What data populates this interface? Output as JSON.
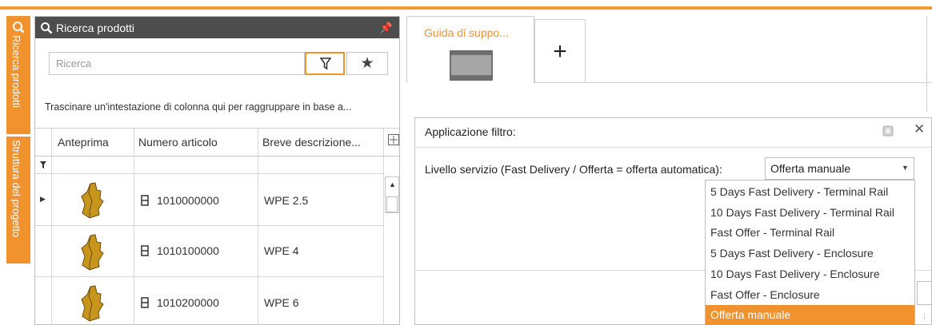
{
  "side_tabs": {
    "search_tab_label": "Ricerca prodotti",
    "project_tab_label": "Struttura del progetto"
  },
  "panel": {
    "title": "Ricerca prodotti",
    "search_placeholder": "Ricerca",
    "group_hint": "Trascinare un'intestazione di colonna qui per raggruppare in base a...",
    "columns": [
      "Anteprima",
      "Numero articolo",
      "Breve descrizione..."
    ],
    "rows": [
      {
        "number": "1010000000",
        "description": "WPE 2.5"
      },
      {
        "number": "1010100000",
        "description": "WPE 4"
      },
      {
        "number": "1010200000",
        "description": "WPE 6"
      }
    ]
  },
  "tabs": {
    "active_label": "Guida di suppo...",
    "add_label": "+"
  },
  "dialog": {
    "title": "Applicazione filtro:",
    "field_label": "Livello servizio (Fast Delivery / Offerta = offerta automatica):",
    "selected_value": "Offerta manuale",
    "options": [
      "5 Days Fast Delivery  - Terminal Rail",
      "10 Days Fast Delivery  - Terminal Rail",
      "Fast Offer - Terminal Rail",
      "5 Days Fast Delivery - Enclosure",
      "10 Days Fast Delivery - Enclosure",
      "Fast Offer - Enclosure",
      "Offerta manuale"
    ],
    "selected_index": 6
  },
  "colors": {
    "accent": "#f0922e",
    "header_bg": "#4d4d4d",
    "product_thumb": "#c8951c"
  }
}
